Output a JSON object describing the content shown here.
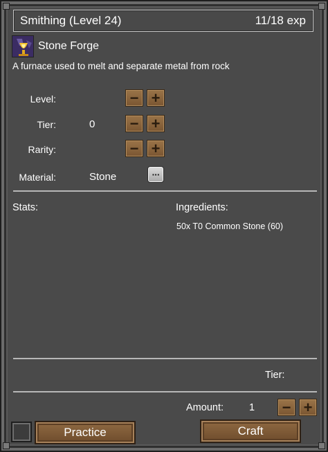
{
  "window": {
    "title": "Smithing (Level 24)",
    "exp": "11/18 exp"
  },
  "item": {
    "icon": "forge-icon",
    "name": "Stone Forge",
    "description": "A furnace used to melt and separate metal from rock"
  },
  "options": {
    "level_label": "Level:",
    "tier_label": "Tier:",
    "tier_value": "0",
    "rarity_label": "Rarity:",
    "material_label": "Material:",
    "material_value": "Stone",
    "minus_glyph": "−",
    "plus_glyph": "+",
    "dots_glyph": "···"
  },
  "stats": {
    "label": "Stats:"
  },
  "ingredients": {
    "label": "Ingredients:",
    "items": [
      "50x T0 Common Stone (60)"
    ]
  },
  "footer": {
    "tier_label": "Tier:",
    "amount_label": "Amount:",
    "amount_value": "1",
    "practice_label": "Practice",
    "craft_label": "Craft"
  },
  "colors": {
    "panel": "#4a4a4a",
    "wood_button": "#7a5632",
    "divider": "#b8b8b8"
  }
}
